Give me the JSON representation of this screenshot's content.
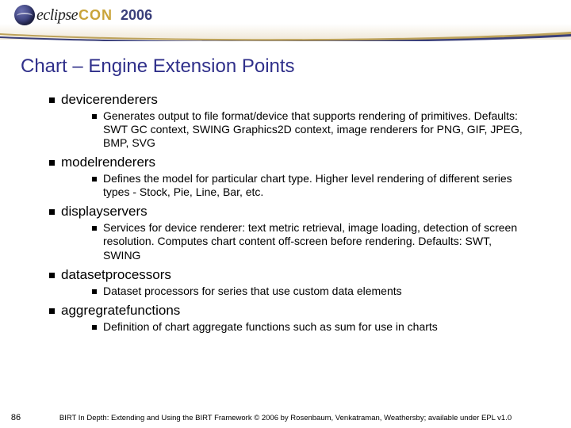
{
  "header": {
    "logo_eclipse": "eclipse",
    "logo_con": "CON",
    "year": "2006"
  },
  "title": "Chart – Engine Extension Points",
  "topics": [
    {
      "name": "devicerenderers",
      "desc": "Generates output to file format/device that supports rendering of primitives. Defaults: SWT GC context, SWING Graphics2D context, image renderers for PNG, GIF, JPEG, BMP, SVG"
    },
    {
      "name": "modelrenderers",
      "desc": "Defines the model for particular chart type. Higher level rendering of different series types - Stock, Pie, Line, Bar, etc."
    },
    {
      "name": "displayservers",
      "desc": "Services for device renderer: text metric retrieval, image loading, detection of screen resolution. Computes chart content off-screen before rendering. Defaults: SWT, SWING"
    },
    {
      "name": "datasetprocessors",
      "desc": "Dataset processors for series that use custom data elements"
    },
    {
      "name": "aggregratefunctions",
      "desc": "Definition of chart aggregate functions such as sum for use in charts"
    }
  ],
  "footer": {
    "page": "86",
    "text": "BIRT In Depth: Extending and Using the BIRT Framework © 2006 by Rosenbaum, Venkatraman, Weathersby; available under EPL v1.0"
  }
}
